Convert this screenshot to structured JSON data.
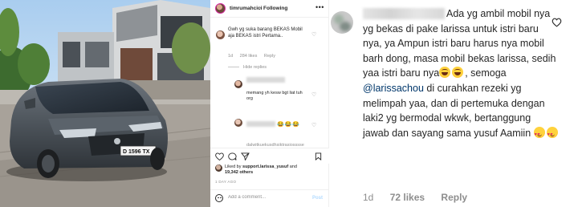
{
  "post": {
    "username": "timrumahcici",
    "separator": "•",
    "follow_status": "Following",
    "more_label": "•••",
    "comment1": {
      "username": "",
      "text": "Gwh yg suka barang BEKAS Mobil aja BEKAS istri Pertama..",
      "age": "1d",
      "likes": "284 likes",
      "reply_label": "Reply"
    },
    "replies_toggle": "Hide replies",
    "reply1": {
      "text": "memang yh kesw bgt liat tuh org"
    },
    "reply2": {
      "emoji": "😂😂😂"
    },
    "cut_text": "dalwitkuekusdhsiktrasiosssse",
    "liked_by_prefix": "Liked by ",
    "liked_by_user": "support.larissa_yusuf",
    "liked_by_and": " and",
    "liked_by_count": "19,342 others",
    "date": "1 DAY AGO",
    "add_comment_placeholder": "Add a comment...",
    "post_button": "Post"
  },
  "zoom": {
    "line_a": "Ada yg ambil mobil nya yg bekas di pake larissa untuk istri baru nya, ya Ampun istri baru harus nya mobil barh dong, masa mobil bekas larissa, sedih yaa istri baru nya",
    "line_b": ", semoga ",
    "mention": "@larissachou",
    "line_c": " di curahkan rezeki yg melimpah yaa, dan di pertemuka dengan laki2 yg bermodal wkwk, bertanggung jawab dan sayang sama yusuf Aamiin ",
    "age": "1d",
    "likes": "72 likes",
    "reply_label": "Reply"
  },
  "colors": {
    "text": "#262626",
    "secondary": "#8e8e8e",
    "mention": "#00376b",
    "post_button": "#b3dbff"
  },
  "icons": [
    "heart-icon",
    "comment-icon",
    "share-icon",
    "bookmark-icon",
    "emoji-icon",
    "more-icon"
  ]
}
